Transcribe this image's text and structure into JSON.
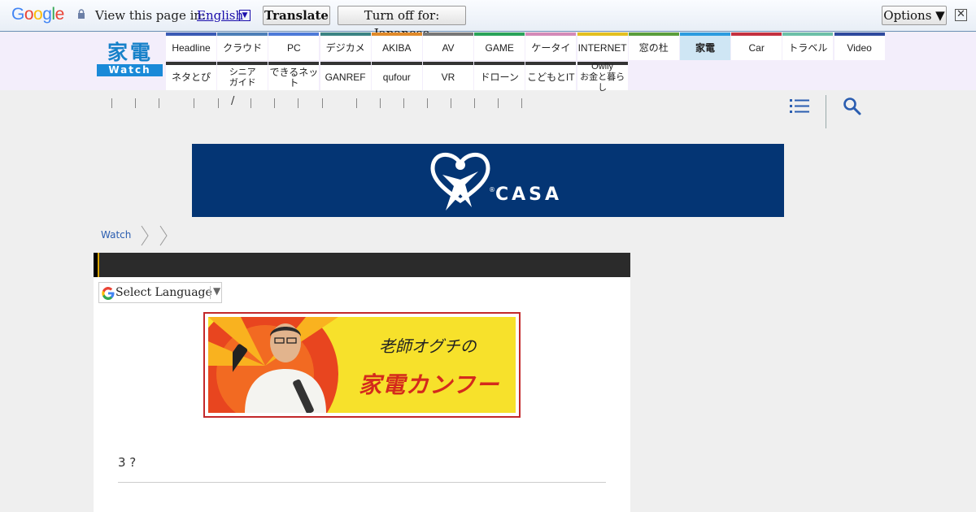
{
  "translate_bar": {
    "logo_text": "Google",
    "logo_letters": [
      {
        "ch": "G",
        "color": "#4285f4"
      },
      {
        "ch": "o",
        "color": "#ea4335"
      },
      {
        "ch": "o",
        "color": "#fbbc05"
      },
      {
        "ch": "g",
        "color": "#4285f4"
      },
      {
        "ch": "l",
        "color": "#34a853"
      },
      {
        "ch": "e",
        "color": "#ea4335"
      }
    ],
    "view_label": "View this page in:",
    "language": "English",
    "translate_button": "Translate",
    "turn_off_button": "Turn off for: Japanese",
    "options_button": "Options ▼",
    "close_glyph": "✕"
  },
  "site": {
    "logo_kanji": "家電",
    "logo_watch": "Watch",
    "nav_row1": [
      {
        "label": "Headline",
        "color": "#3b5bb5"
      },
      {
        "label": "クラウド",
        "color": "#4d7fb8"
      },
      {
        "label": "PC",
        "color": "#4d7ad8"
      },
      {
        "label": "デジカメ",
        "color": "#3b8484"
      },
      {
        "label": "AKIBA",
        "color": "#e08a2a"
      },
      {
        "label": "AV",
        "color": "#777777"
      },
      {
        "label": "GAME",
        "color": "#2aa35a"
      },
      {
        "label": "ケータイ",
        "color": "#d48ab8"
      },
      {
        "label": "INTERNET",
        "color": "#e3c020"
      },
      {
        "label": "窓の杜",
        "color": "#5a9e3c"
      },
      {
        "label": "家電",
        "color": "#2b9be0",
        "active": true
      },
      {
        "label": "Car",
        "color": "#c43040"
      },
      {
        "label": "トラベル",
        "color": "#6cc0a8"
      },
      {
        "label": "Video",
        "color": "#2e4a9e"
      }
    ],
    "nav_row2": [
      {
        "label": "ネタとぴ"
      },
      {
        "label": "シニア\nガイド"
      },
      {
        "label": "できるネット"
      },
      {
        "label": "GANREF"
      },
      {
        "label": "qufour"
      },
      {
        "label": "VR"
      },
      {
        "label": "ドローン"
      },
      {
        "label": "こどもとIT"
      },
      {
        "label": "Owlly\nお金と暮らし"
      }
    ]
  },
  "sub_bar": {
    "slash": "/",
    "menu_icon": "hamburger-list-icon",
    "search_icon": "magnifier-icon"
  },
  "ad": {
    "brand": "CASA",
    "registered": "®",
    "background": "#043574"
  },
  "breadcrumb": {
    "root": "Watch"
  },
  "article": {
    "language_select_label": "Select Language",
    "language_select_arrow": "▼",
    "banner_title": "老師オグチの",
    "banner_main": "家電カンフー",
    "text": "3 ?"
  }
}
